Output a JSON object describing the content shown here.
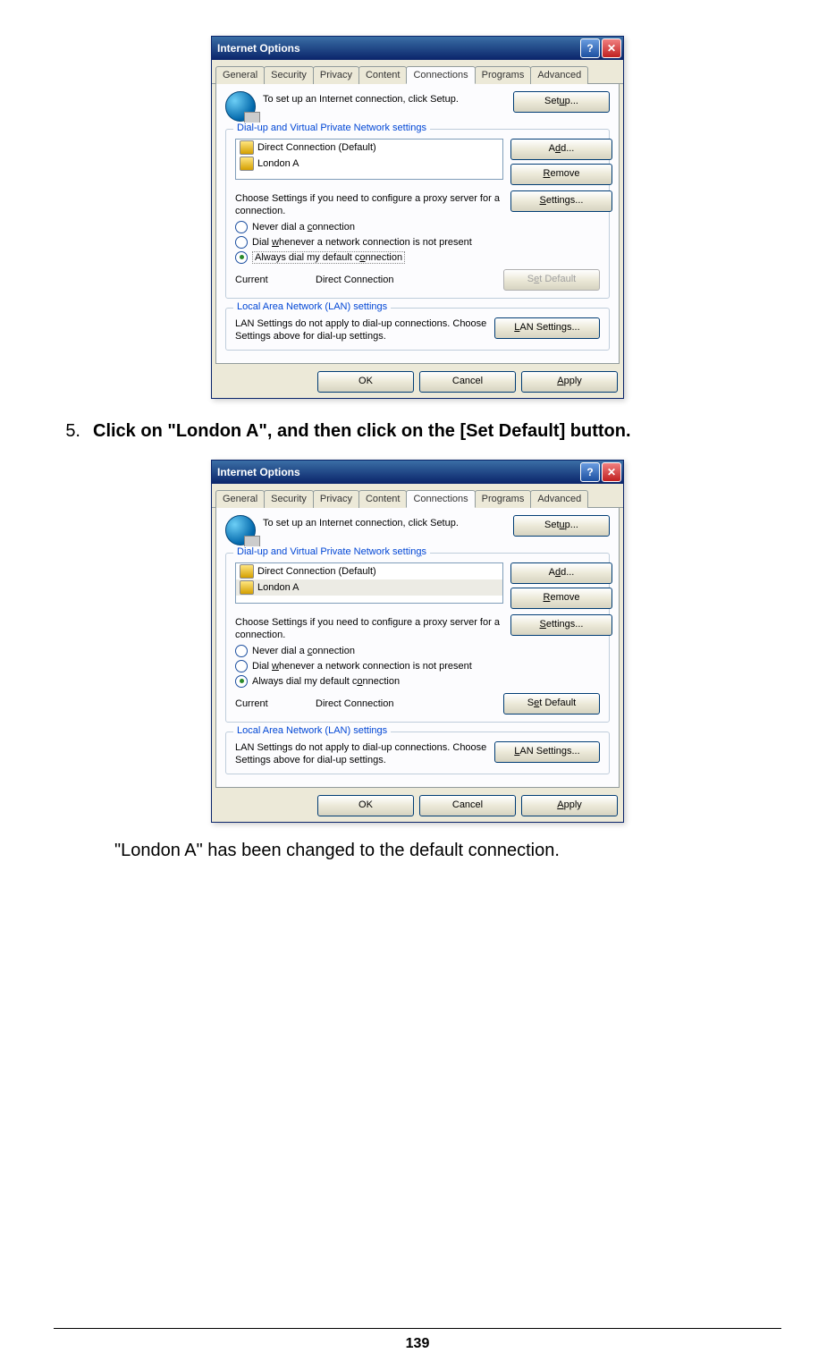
{
  "dialog": {
    "title": "Internet Options",
    "tabs": [
      "General",
      "Security",
      "Privacy",
      "Content",
      "Connections",
      "Programs",
      "Advanced"
    ],
    "active_tab": "Connections",
    "setup_intro": "To set up an Internet connection, click Setup.",
    "setup_button": "Setup...",
    "group_dialup_title": "Dial-up and Virtual Private Network settings",
    "connections": [
      {
        "name": "Direct Connection (Default)"
      },
      {
        "name": "London A"
      }
    ],
    "add_button": "Add...",
    "remove_button": "Remove",
    "settings_button": "Settings...",
    "proxy_text": "Choose Settings if you need to configure a proxy server for a connection.",
    "radio_never": "Never dial a connection",
    "radio_dialwhen": "Dial whenever a network connection is not present",
    "radio_always": "Always dial my default connection",
    "current_label": "Current",
    "current_value": "Direct Connection",
    "set_default_button": "Set Default",
    "group_lan_title": "Local Area Network (LAN) settings",
    "lan_text": "LAN Settings do not apply to dial-up connections. Choose Settings above for dial-up settings.",
    "lan_button": "LAN Settings...",
    "ok_button": "OK",
    "cancel_button": "Cancel",
    "apply_button": "Apply"
  },
  "step": {
    "number": "5.",
    "text": "Click on \"London A\", and then click on the [Set Default] button."
  },
  "caption": "\"London A\" has been changed to the default connection.",
  "page_number": "139"
}
